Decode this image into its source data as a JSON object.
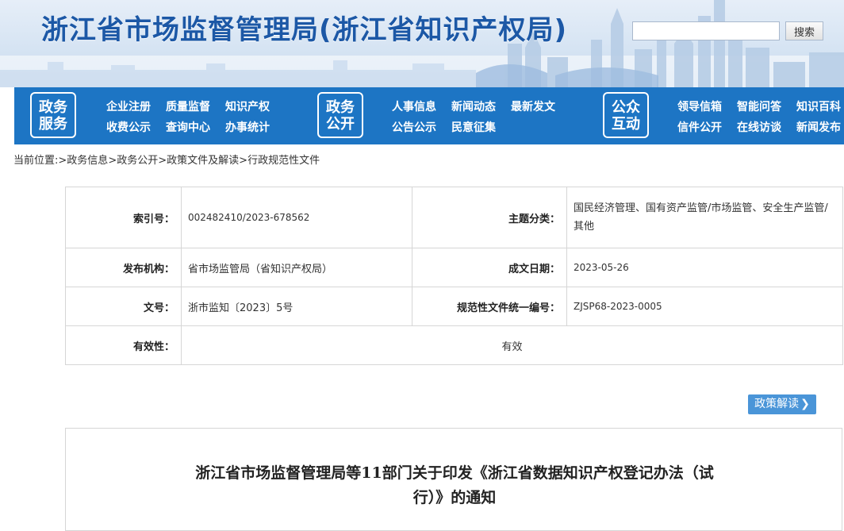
{
  "header": {
    "site_title": "浙江省市场监督管理局(浙江省知识产权局)",
    "search_placeholder": "",
    "search_button": "搜索"
  },
  "nav": {
    "groups": [
      {
        "badge": [
          "政务",
          "服务"
        ],
        "links": [
          [
            "企业注册",
            "质量监督",
            "知识产权"
          ],
          [
            "收费公示",
            "查询中心",
            "办事统计"
          ]
        ]
      },
      {
        "badge": [
          "政务",
          "公开"
        ],
        "links": [
          [
            "人事信息",
            "新闻动态",
            "最新发文"
          ],
          [
            "公告公示",
            "民意征集"
          ]
        ]
      },
      {
        "badge": [
          "公众",
          "互动"
        ],
        "links": [
          [
            "领导信箱",
            "智能问答",
            "知识百科"
          ],
          [
            "信件公开",
            "在线访谈",
            "新闻发布"
          ]
        ]
      }
    ]
  },
  "breadcrumb": {
    "prefix": "当前位置:",
    "items": [
      "政务信息",
      "政务公开",
      "政策文件及解读",
      "行政规范性文件"
    ],
    "separator": ">"
  },
  "meta": {
    "index_no": {
      "label": "索引号：",
      "value": "002482410/2023-678562"
    },
    "subject": {
      "label": "主题分类：",
      "value": "国民经济管理、国有资产监管/市场监管、安全生产监管/其他"
    },
    "issuer": {
      "label": "发布机构：",
      "value": "省市场监管局（省知识产权局）"
    },
    "date": {
      "label": "成文日期：",
      "value": "2023-05-26"
    },
    "doc_no": {
      "label": "文号：",
      "value": "浙市监知〔2023〕5号"
    },
    "unified_no": {
      "label": "规范性文件统一编号：",
      "value": "ZJSP68-2023-0005"
    },
    "validity": {
      "label": "有效性：",
      "value": "有效"
    }
  },
  "interpretation_button": {
    "label": "政策解读",
    "chevron": "❯"
  },
  "document": {
    "title_lines": [
      "浙江省市场监督管理局等11部门关于印发《浙江省数据知识产权登记办法（试",
      "行）》的通知"
    ]
  },
  "colors": {
    "nav_blue": "#1d75c4",
    "title_blue": "#1c58a6",
    "button_blue": "#4a95d8"
  }
}
